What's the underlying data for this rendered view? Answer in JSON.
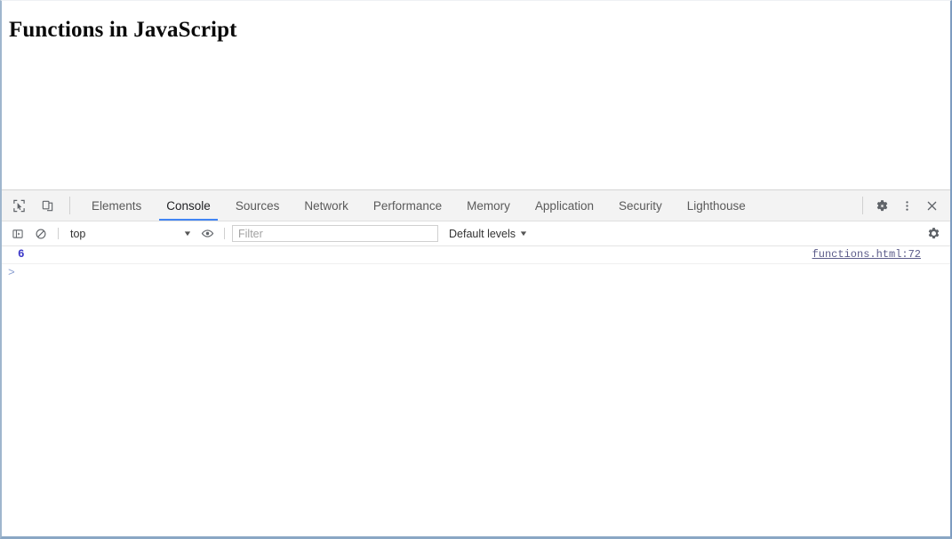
{
  "page": {
    "title": "Functions in JavaScript"
  },
  "devtools": {
    "inspect_icon": "inspect-element-icon",
    "device_icon": "device-toolbar-icon",
    "tabs": [
      {
        "label": "Elements",
        "active": false
      },
      {
        "label": "Console",
        "active": true
      },
      {
        "label": "Sources",
        "active": false
      },
      {
        "label": "Network",
        "active": false
      },
      {
        "label": "Performance",
        "active": false
      },
      {
        "label": "Memory",
        "active": false
      },
      {
        "label": "Application",
        "active": false
      },
      {
        "label": "Security",
        "active": false
      },
      {
        "label": "Lighthouse",
        "active": false
      }
    ],
    "tabbar_actions": {
      "settings_icon": "gear-icon",
      "more_icon": "kebab-menu-icon",
      "close_icon": "close-icon"
    },
    "console_toolbar": {
      "sidebar_icon": "console-sidebar-icon",
      "clear_icon": "clear-console-icon",
      "context_value": "top",
      "context_caret": "▼",
      "eye_icon": "live-expression-eye-icon",
      "filter_placeholder": "Filter",
      "filter_value": "",
      "levels_label": "Default levels",
      "levels_caret": "▼",
      "settings_icon": "console-settings-gear-icon"
    },
    "console": {
      "messages": [
        {
          "value": "6",
          "source": "functions.html:72"
        }
      ],
      "prompt_symbol": ">",
      "prompt_value": ""
    }
  },
  "colors": {
    "accent": "#4285f4",
    "number_result": "#3a36c8",
    "prompt": "#8a9fd0",
    "toolbar_bg": "#f3f3f3",
    "frame_border": "#8aa7c4"
  }
}
